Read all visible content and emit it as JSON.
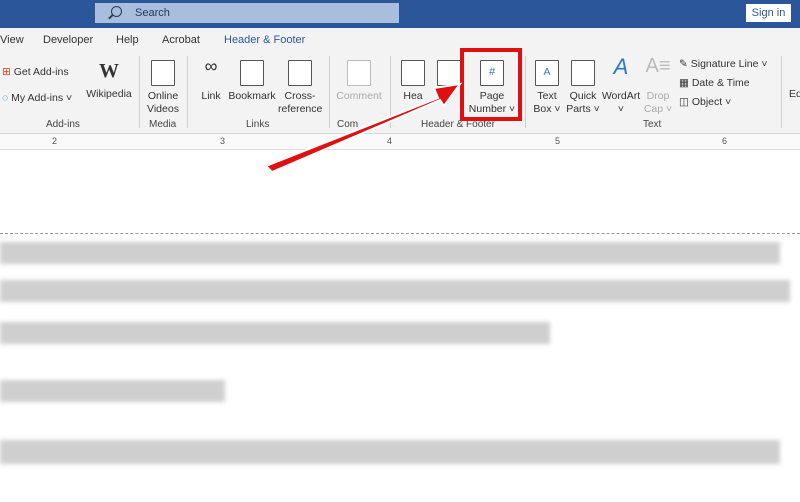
{
  "titlebar": {
    "search_placeholder": "Search",
    "sign_in": "Sign in"
  },
  "tabs": [
    "View",
    "Developer",
    "Help",
    "Acrobat",
    "Header & Footer"
  ],
  "active_tab": "Header & Footer",
  "ribbon": {
    "addins": {
      "get": "Get Add-ins",
      "my": "My Add-ins",
      "wikipedia": "Wikipedia",
      "group": "Add-ins"
    },
    "media": {
      "online_videos_1": "Online",
      "online_videos_2": "Videos",
      "group": "Media"
    },
    "links": {
      "link": "Link",
      "bookmark": "Bookmark",
      "cross_1": "Cross-",
      "cross_2": "reference",
      "group": "Links"
    },
    "comments": {
      "comment": "Comment",
      "group": "Com"
    },
    "header_footer": {
      "header": "Hea",
      "page_1": "Page",
      "page_2": "Number",
      "group": "Header & Footer"
    },
    "text": {
      "textbox_1": "Text",
      "textbox_2": "Box",
      "quick_1": "Quick",
      "quick_2": "Parts",
      "wordart": "WordArt",
      "drop_1": "Drop",
      "drop_2": "Cap",
      "signature": "Signature Line",
      "datetime": "Date & Time",
      "object": "Object",
      "group": "Text"
    },
    "eq": "Eq"
  },
  "ruler": [
    "2",
    "3",
    "4",
    "5",
    "6"
  ],
  "colors": {
    "titlebar": "#2b579a",
    "accent_tab": "#2b579a",
    "highlight": "#e01010"
  }
}
